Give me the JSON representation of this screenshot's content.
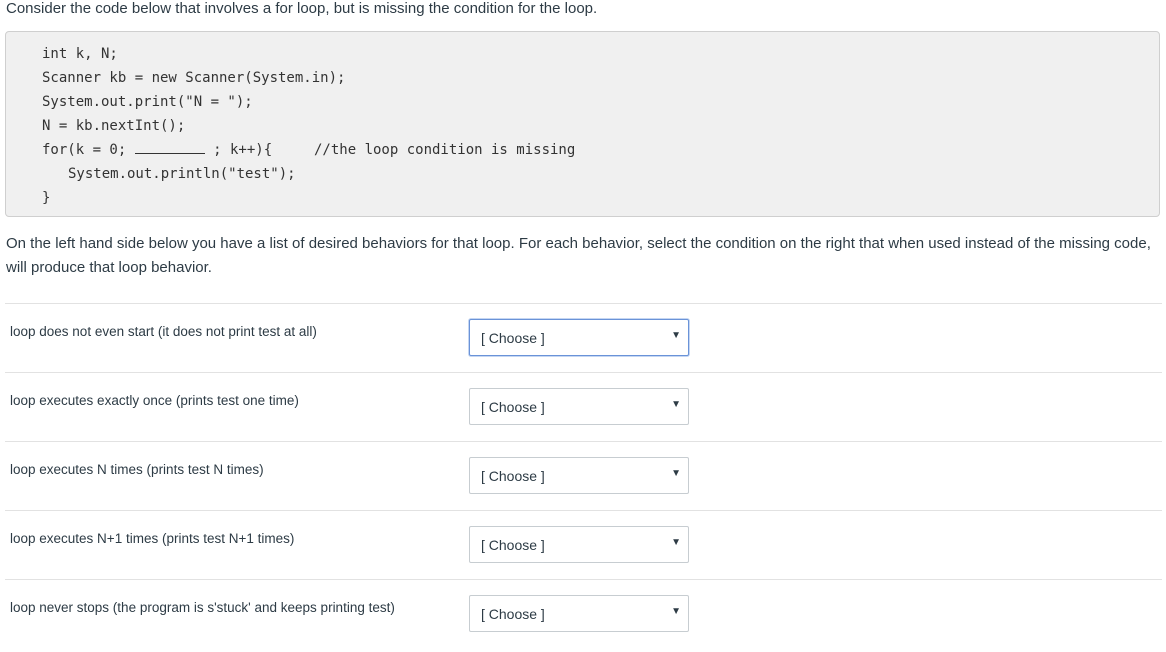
{
  "intro": "Consider the code below that involves a for loop, but is missing the condition for the loop.",
  "code": {
    "line1": "int k, N;",
    "line2": "Scanner kb = new Scanner(System.in);",
    "line3": "System.out.print(\"N = \");",
    "line4": "N = kb.nextInt();",
    "line5_start": "for(k = 0; ",
    "line5_end": " ; k++){",
    "line5_comment": "//the loop condition is missing",
    "line6": "System.out.println(\"test\");",
    "line7": "}"
  },
  "instructions": "On the left hand side below you have a list of desired behaviors for that loop. For each behavior, select the condition on the right  that when used instead of the missing code, will produce that loop behavior.",
  "rows": [
    {
      "label": "loop does not even start (it does not print test at all)",
      "selected": "[ Choose ]"
    },
    {
      "label": "loop executes exactly once (prints test one time)",
      "selected": "[ Choose ]"
    },
    {
      "label": "loop executes N times (prints test N times)",
      "selected": "[ Choose ]"
    },
    {
      "label": "loop executes N+1 times (prints test N+1 times)",
      "selected": "[ Choose ]"
    },
    {
      "label": "loop never stops (the program is s'stuck' and keeps printing test)",
      "selected": "[ Choose ]"
    }
  ],
  "caret_icon": "▼"
}
